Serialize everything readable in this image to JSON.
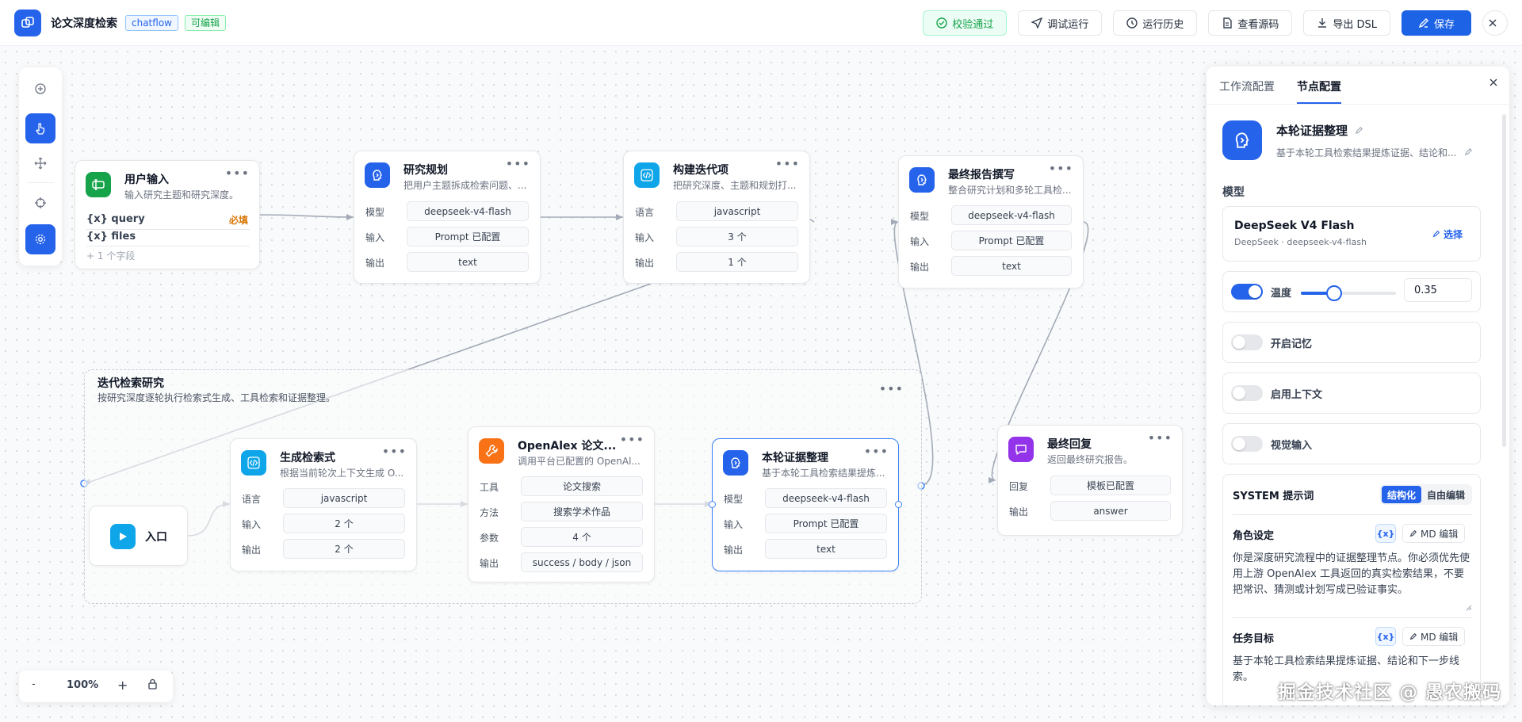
{
  "header": {
    "title": "论文深度检索",
    "tag_type": "chatflow",
    "tag_edit": "可编辑",
    "validate_label": "校验通过",
    "debug_label": "调试运行",
    "history_label": "运行历史",
    "source_label": "查看源码",
    "export_label": "导出 DSL",
    "save_label": "保存"
  },
  "zoom": {
    "minus": "-",
    "value": "100%",
    "plus": "+"
  },
  "nodes": {
    "user_input": {
      "title": "用户输入",
      "desc": "输入研究主题和研究深度。",
      "vars": [
        {
          "name": "{x} query",
          "badge": "必填"
        },
        {
          "name": "{x} files"
        }
      ],
      "more_fields": "+ 1 个字段"
    },
    "plan": {
      "title": "研究规划",
      "desc": "把用户主题拆成检索问题、...",
      "rows": [
        {
          "k": "模型",
          "v": "deepseek-v4-flash"
        },
        {
          "k": "输入",
          "v": "Prompt 已配置"
        },
        {
          "k": "输出",
          "v": "text"
        }
      ]
    },
    "build": {
      "title": "构建迭代项",
      "desc": "把研究深度、主题和规划打...",
      "rows": [
        {
          "k": "语言",
          "v": "javascript"
        },
        {
          "k": "输入",
          "v": "3 个"
        },
        {
          "k": "输出",
          "v": "1 个"
        }
      ]
    },
    "report": {
      "title": "最终报告撰写",
      "desc": "整合研究计划和多轮工具检...",
      "rows": [
        {
          "k": "模型",
          "v": "deepseek-v4-flash"
        },
        {
          "k": "输入",
          "v": "Prompt 已配置"
        },
        {
          "k": "输出",
          "v": "text"
        }
      ]
    },
    "group": {
      "title": "迭代检索研究",
      "desc": "按研究深度逐轮执行检索式生成、工具检索和证据整理。"
    },
    "entry": {
      "title": "入口"
    },
    "gen": {
      "title": "生成检索式",
      "desc": "根据当前轮次上下文生成 O...",
      "rows": [
        {
          "k": "语言",
          "v": "javascript"
        },
        {
          "k": "输入",
          "v": "2 个"
        },
        {
          "k": "输出",
          "v": "2 个"
        }
      ]
    },
    "openalex": {
      "title": "OpenAlex 论文...",
      "desc": "调用平台已配置的 OpenAl...",
      "rows": [
        {
          "k": "工具",
          "v": "论文搜索"
        },
        {
          "k": "方法",
          "v": "搜索学术作品"
        },
        {
          "k": "参数",
          "v": "4 个"
        },
        {
          "k": "输出",
          "v": "success / body / json"
        }
      ]
    },
    "evidence": {
      "title": "本轮证据整理",
      "desc": "基于本轮工具检索结果提炼...",
      "rows": [
        {
          "k": "模型",
          "v": "deepseek-v4-flash"
        },
        {
          "k": "输入",
          "v": "Prompt 已配置"
        },
        {
          "k": "输出",
          "v": "text"
        }
      ]
    },
    "final": {
      "title": "最终回复",
      "desc": "返回最终研究报告。",
      "rows": [
        {
          "k": "回复",
          "v": "模板已配置"
        },
        {
          "k": "输出",
          "v": "answer"
        }
      ]
    }
  },
  "panel": {
    "tab_workflow": "工作流配置",
    "tab_node": "节点配置",
    "node_name": "本轮证据整理",
    "node_desc": "基于本轮工具检索结果提炼证据、结论和...",
    "model_label": "模型",
    "model_name": "DeepSeek V4 Flash",
    "model_sub": "DeepSeek · deepseek-v4-flash",
    "model_select": "选择",
    "temperature_label": "温度",
    "temperature_value": "0.35",
    "temperature_fraction": 0.35,
    "memory_label": "开启记忆",
    "context_label": "启用上下文",
    "vision_label": "视觉输入",
    "system_title": "SYSTEM 提示词",
    "mode_structured": "结构化",
    "mode_free": "自由编辑",
    "role_title": "角色设定",
    "var_chip": "{x}",
    "md_edit": "MD 编辑",
    "role_text": "你是深度研究流程中的证据整理节点。你必须优先使用上游 OpenAlex 工具返回的真实检索结果，不要把常识、猜测或计划写成已验证事实。",
    "task_title": "任务目标",
    "task_text": "基于本轮工具检索结果提炼证据、结论和下一步线索。"
  },
  "watermark": "掘金技术社区 @ 愚农搬码"
}
